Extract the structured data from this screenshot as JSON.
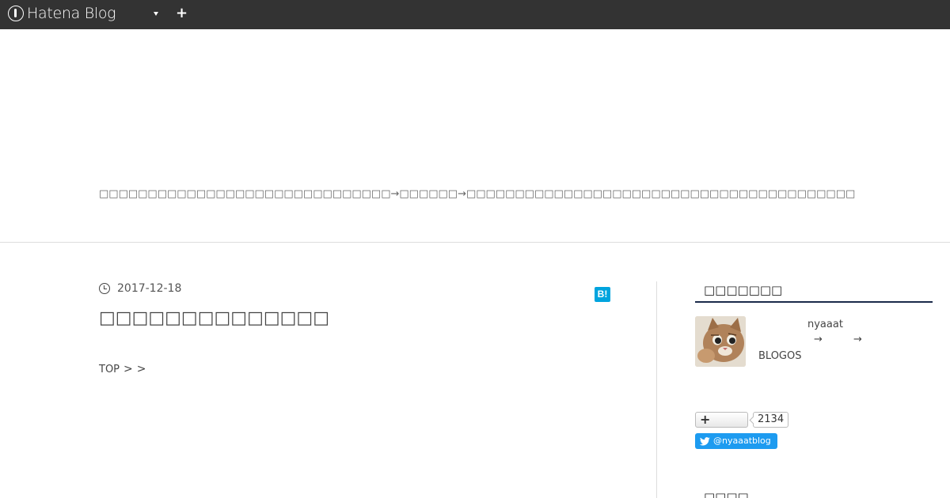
{
  "topbar": {
    "brand": "Hatena Blog",
    "plus": "+"
  },
  "header": {
    "description": "□□□□□□□□□□□□□□□□□□□□□□□□□□□□□□→□□□□□□→□□□□□□□□□□□□□□□□□□□□□□□□□□□□□□□□□□□□□□□□"
  },
  "entry": {
    "date": "2017-12-18",
    "hatebu_label": "B!",
    "title": "□□□□□□□□□□□□□□",
    "breadcrumb": {
      "top": "TOP",
      "sep1": ">",
      "sep2": ">"
    }
  },
  "sidebar": {
    "profile_heading": "□□□□□□□",
    "profile_name": "nyaaat",
    "arrow1": "→",
    "arrow2": "→",
    "blogos": "BLOGOS",
    "follow_plus": "+",
    "follow_count": "2134",
    "twitter_handle": "@nyaaatblog",
    "next_heading": "□□□□"
  },
  "colors": {
    "topbar": "#333333",
    "hatebu": "#00a4de",
    "twitter": "#1d9bf0",
    "heading_rule": "#1a2a4a"
  }
}
